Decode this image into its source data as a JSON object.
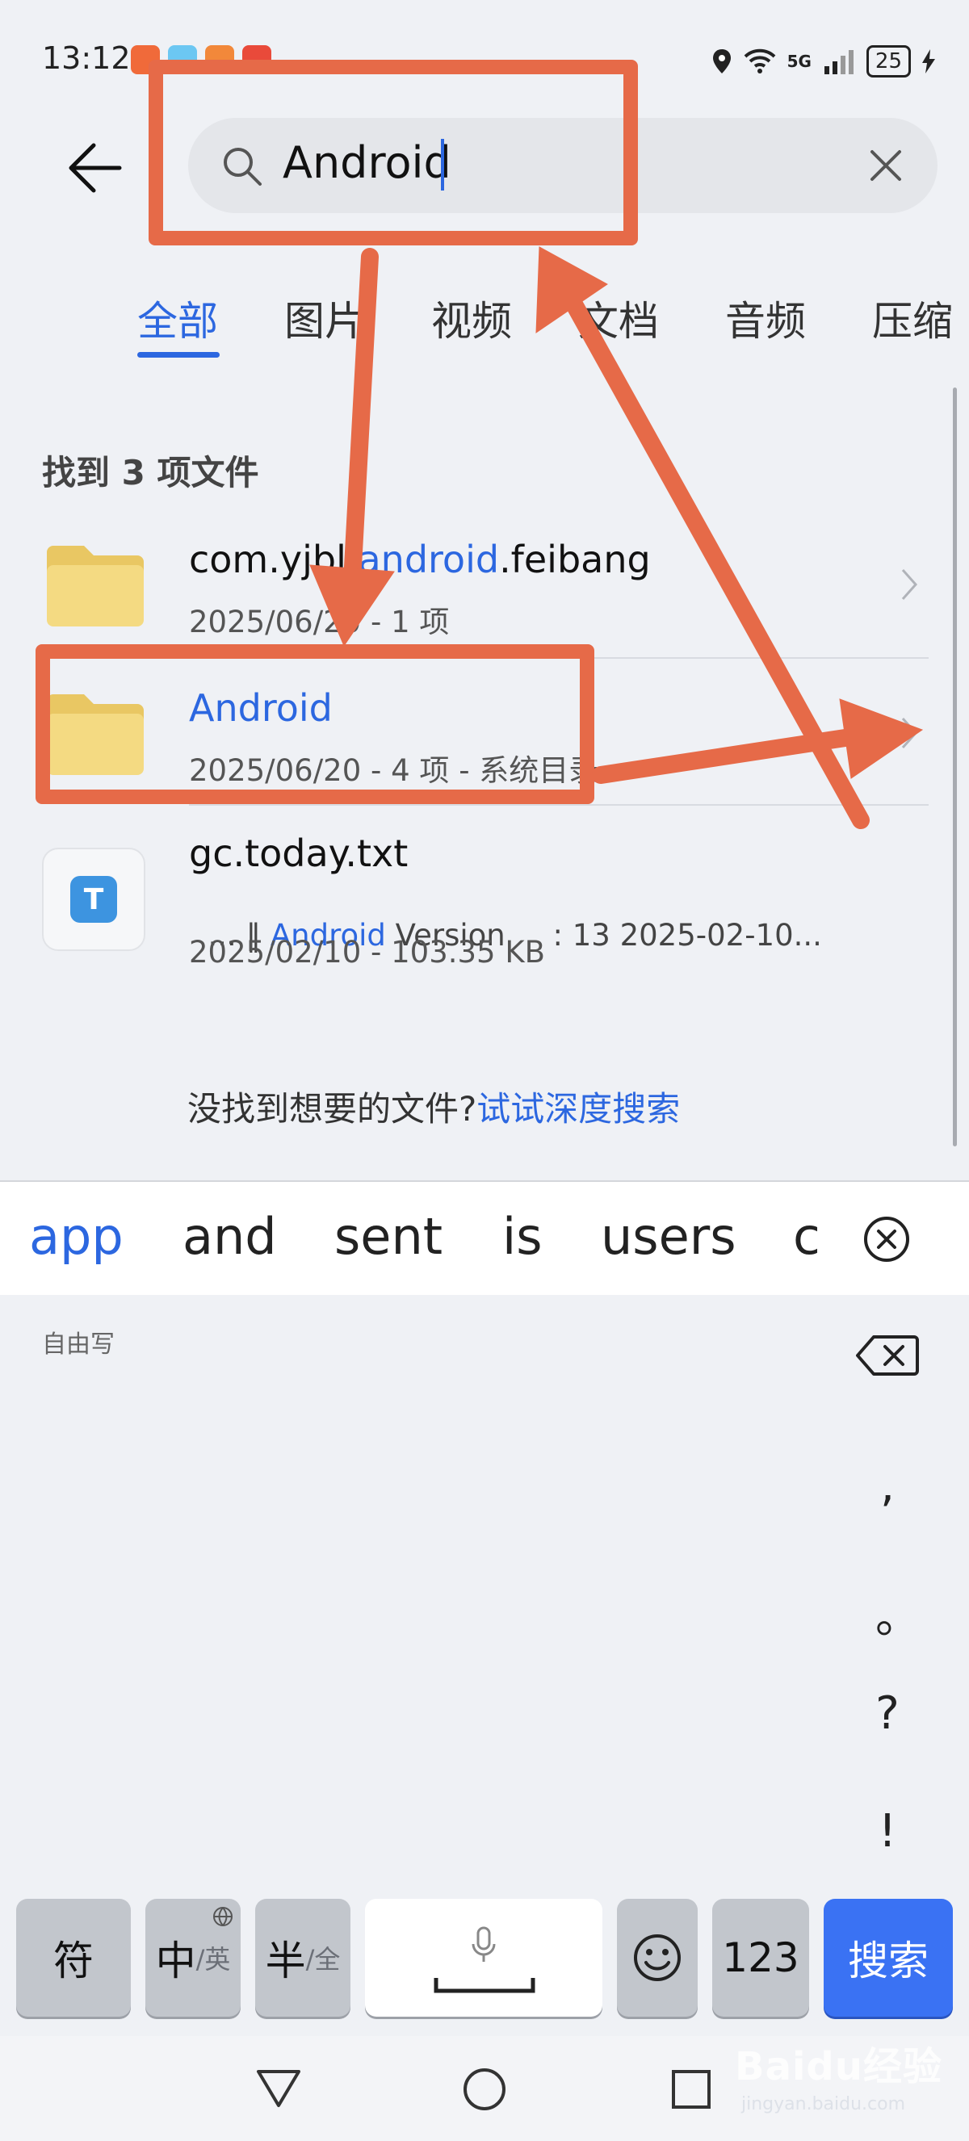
{
  "status": {
    "time": "13:12",
    "network": "5G",
    "sim": "6",
    "battery": "25",
    "app_icons": [
      "#f06a3a",
      "#6cc7f2",
      "#f2883a",
      "#e94a3a"
    ]
  },
  "search": {
    "query": "Android",
    "clear_icon": "close-icon",
    "search_icon": "search-icon"
  },
  "tabs": [
    "全部",
    "图片",
    "视频",
    "文档",
    "音频",
    "压缩"
  ],
  "active_tab": "全部",
  "result_count": "找到 3 项文件",
  "results": [
    {
      "title_pre": "com.yjbl.",
      "title_hl": "android",
      "title_post": ".feibang",
      "subtitle": "2025/06/20 - 1 项",
      "type": "folder"
    },
    {
      "title_pre": "",
      "title_hl": "Android",
      "title_post": "",
      "subtitle": "2025/06/20 - 4 项 - 系统目录",
      "type": "folder"
    },
    {
      "title": "gc.today.txt",
      "snippet_pre": "... ‖ ",
      "snippet_hl": "Android",
      "snippet_post": " Version     : 13 2025-02-10...",
      "subtitle": "2025/02/10 - 103.35 KB",
      "type": "text-file",
      "icon_letter": "T"
    }
  ],
  "deep_search": {
    "prompt": "没找到想要的文件?",
    "link": "试试深度搜索"
  },
  "keyboard": {
    "suggestions": [
      "app",
      "and",
      "sent",
      "is",
      "users",
      "c"
    ],
    "freewrite_label": "自由写",
    "punctuation": [
      ",",
      "。",
      "?",
      "!"
    ],
    "keys": {
      "symbol": "符",
      "lang_main": "中",
      "lang_alt": "/英",
      "width_main": "半",
      "width_alt": "/全",
      "numbers": "123",
      "search": "搜索"
    }
  },
  "watermark": {
    "brand": "Baidu经验",
    "url": "jingyan.baidu.com"
  },
  "colors": {
    "accent": "#2c67e0",
    "annotation": "#e66a48",
    "folder": "#f2d67a",
    "search_key": "#3a72f3"
  }
}
